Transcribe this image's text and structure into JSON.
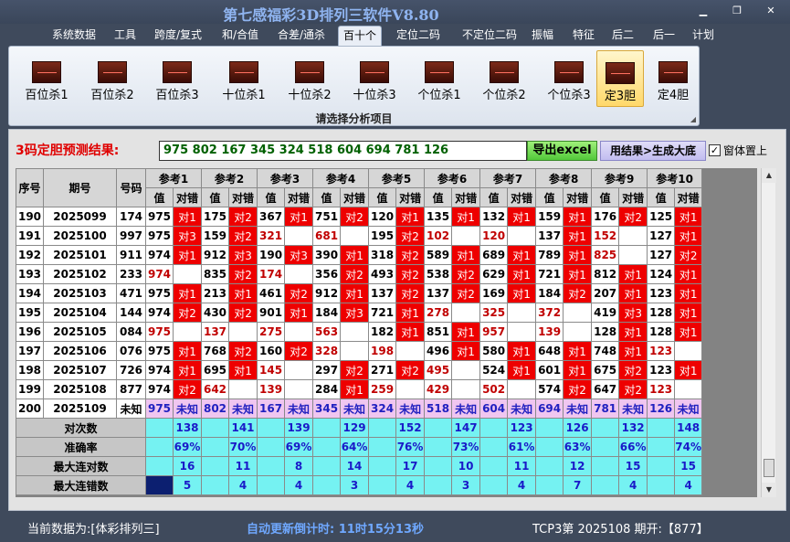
{
  "window": {
    "title": "第七感福彩3D排列三软件V8.80"
  },
  "menu": [
    "系统数据",
    "工具",
    "跨度/复式",
    "和/合值",
    "合差/通杀",
    "百十个",
    "定位二码",
    "不定位二码",
    "振幅",
    "特征",
    "后二",
    "后一",
    "计划"
  ],
  "menu_active": "百十个",
  "ribbon": {
    "buttons": [
      "百位杀1",
      "百位杀2",
      "百位杀3",
      "十位杀1",
      "十位杀2",
      "十位杀3",
      "个位杀1",
      "个位杀2",
      "个位杀3",
      "定3胆",
      "定4胆"
    ],
    "selected": "定3胆",
    "caption": "请选择分析项目"
  },
  "prediction": {
    "label": "3码定胆预测结果:",
    "value": "975 802 167 345 324 518 604 694 781 126"
  },
  "buttons": {
    "export": "导出excel",
    "generate": "用结果>生成大底"
  },
  "topmost": {
    "label": "窗体置上",
    "checked": true,
    "mark": "✓"
  },
  "table": {
    "header": {
      "seq": "序号",
      "period": "期号",
      "number": "号码",
      "refs": [
        "参考1",
        "参考2",
        "参考3",
        "参考4",
        "参考5",
        "参考6",
        "参考7",
        "参考8",
        "参考9",
        "参考10"
      ],
      "value": "值",
      "check": "对错"
    },
    "rows": [
      {
        "seq": "190",
        "period": "2025099",
        "number": "174",
        "cells": [
          [
            "975",
            "对1"
          ],
          [
            "175",
            "对2"
          ],
          [
            "367",
            "对1"
          ],
          [
            "751",
            "对2"
          ],
          [
            "120",
            "对1"
          ],
          [
            "135",
            "对1"
          ],
          [
            "132",
            "对1"
          ],
          [
            "159",
            "对1"
          ],
          [
            "176",
            "对2"
          ],
          [
            "125",
            "对1"
          ]
        ]
      },
      {
        "seq": "191",
        "period": "2025100",
        "number": "997",
        "cells": [
          [
            "975",
            "对3"
          ],
          [
            "159",
            "对2"
          ],
          [
            "321",
            ""
          ],
          [
            "681",
            ""
          ],
          [
            "195",
            "对2"
          ],
          [
            "102",
            ""
          ],
          [
            "120",
            ""
          ],
          [
            "137",
            "对1"
          ],
          [
            "152",
            ""
          ],
          [
            "127",
            "对1"
          ]
        ]
      },
      {
        "seq": "192",
        "period": "2025101",
        "number": "911",
        "cells": [
          [
            "974",
            "对1"
          ],
          [
            "912",
            "对3"
          ],
          [
            "190",
            "对3"
          ],
          [
            "390",
            "对1"
          ],
          [
            "318",
            "对2"
          ],
          [
            "589",
            "对1"
          ],
          [
            "689",
            "对1"
          ],
          [
            "789",
            "对1"
          ],
          [
            "825",
            ""
          ],
          [
            "127",
            "对2"
          ]
        ]
      },
      {
        "seq": "193",
        "period": "2025102",
        "number": "233",
        "cells": [
          [
            "974",
            ""
          ],
          [
            "835",
            "对2"
          ],
          [
            "174",
            ""
          ],
          [
            "356",
            "对2"
          ],
          [
            "493",
            "对2"
          ],
          [
            "538",
            "对2"
          ],
          [
            "629",
            "对1"
          ],
          [
            "721",
            "对1"
          ],
          [
            "812",
            "对1"
          ],
          [
            "124",
            "对1"
          ]
        ]
      },
      {
        "seq": "194",
        "period": "2025103",
        "number": "471",
        "cells": [
          [
            "975",
            "对1"
          ],
          [
            "213",
            "对1"
          ],
          [
            "461",
            "对2"
          ],
          [
            "912",
            "对1"
          ],
          [
            "137",
            "对2"
          ],
          [
            "137",
            "对2"
          ],
          [
            "169",
            "对1"
          ],
          [
            "184",
            "对2"
          ],
          [
            "207",
            "对1"
          ],
          [
            "123",
            "对1"
          ]
        ]
      },
      {
        "seq": "195",
        "period": "2025104",
        "number": "144",
        "cells": [
          [
            "974",
            "对2"
          ],
          [
            "430",
            "对2"
          ],
          [
            "901",
            "对1"
          ],
          [
            "184",
            "对3"
          ],
          [
            "721",
            "对1"
          ],
          [
            "278",
            ""
          ],
          [
            "325",
            ""
          ],
          [
            "372",
            ""
          ],
          [
            "419",
            "对3"
          ],
          [
            "128",
            "对1"
          ]
        ]
      },
      {
        "seq": "196",
        "period": "2025105",
        "number": "084",
        "cells": [
          [
            "975",
            ""
          ],
          [
            "137",
            ""
          ],
          [
            "275",
            ""
          ],
          [
            "563",
            ""
          ],
          [
            "182",
            "对1"
          ],
          [
            "851",
            "对1"
          ],
          [
            "957",
            ""
          ],
          [
            "139",
            ""
          ],
          [
            "128",
            "对1"
          ],
          [
            "128",
            "对1"
          ]
        ]
      },
      {
        "seq": "197",
        "period": "2025106",
        "number": "076",
        "cells": [
          [
            "975",
            "对1"
          ],
          [
            "768",
            "对2"
          ],
          [
            "160",
            "对2"
          ],
          [
            "328",
            ""
          ],
          [
            "198",
            ""
          ],
          [
            "496",
            "对1"
          ],
          [
            "580",
            "对1"
          ],
          [
            "648",
            "对1"
          ],
          [
            "748",
            "对1"
          ],
          [
            "123",
            ""
          ]
        ]
      },
      {
        "seq": "198",
        "period": "2025107",
        "number": "726",
        "cells": [
          [
            "974",
            "对1"
          ],
          [
            "695",
            "对1"
          ],
          [
            "145",
            ""
          ],
          [
            "297",
            "对2"
          ],
          [
            "271",
            "对2"
          ],
          [
            "495",
            ""
          ],
          [
            "524",
            "对1"
          ],
          [
            "601",
            "对1"
          ],
          [
            "675",
            "对2"
          ],
          [
            "123",
            "对1"
          ]
        ]
      },
      {
        "seq": "199",
        "period": "2025108",
        "number": "877",
        "cells": [
          [
            "974",
            "对2"
          ],
          [
            "642",
            ""
          ],
          [
            "139",
            ""
          ],
          [
            "284",
            "对1"
          ],
          [
            "259",
            ""
          ],
          [
            "429",
            ""
          ],
          [
            "502",
            ""
          ],
          [
            "574",
            "对2"
          ],
          [
            "647",
            "对2"
          ],
          [
            "123",
            ""
          ]
        ]
      }
    ],
    "pred_row": {
      "seq": "200",
      "period": "2025109",
      "number": "未知",
      "values": [
        "975",
        "802",
        "167",
        "345",
        "324",
        "518",
        "604",
        "694",
        "781",
        "126"
      ],
      "check": "未知"
    },
    "stats": [
      {
        "label": "对次数",
        "values": [
          "138",
          "141",
          "139",
          "129",
          "152",
          "147",
          "123",
          "126",
          "132",
          "148"
        ]
      },
      {
        "label": "准确率",
        "values": [
          "69%",
          "70%",
          "69%",
          "64%",
          "76%",
          "73%",
          "61%",
          "63%",
          "66%",
          "74%"
        ]
      },
      {
        "label": "最大连对数",
        "values": [
          "16",
          "11",
          "8",
          "14",
          "17",
          "10",
          "11",
          "12",
          "15",
          "15"
        ]
      },
      {
        "label": "最大连错数",
        "values": [
          "5",
          "4",
          "4",
          "3",
          "4",
          "3",
          "4",
          "7",
          "4",
          "4"
        ]
      }
    ]
  },
  "scroll": {
    "up": "▲",
    "down": "▼"
  },
  "status": {
    "source": "当前数据为:[体彩排列三]",
    "timer": "自动更新倒计时: 11时15分13秒",
    "draw": "TCP3第 2025108 期开:【877】"
  }
}
